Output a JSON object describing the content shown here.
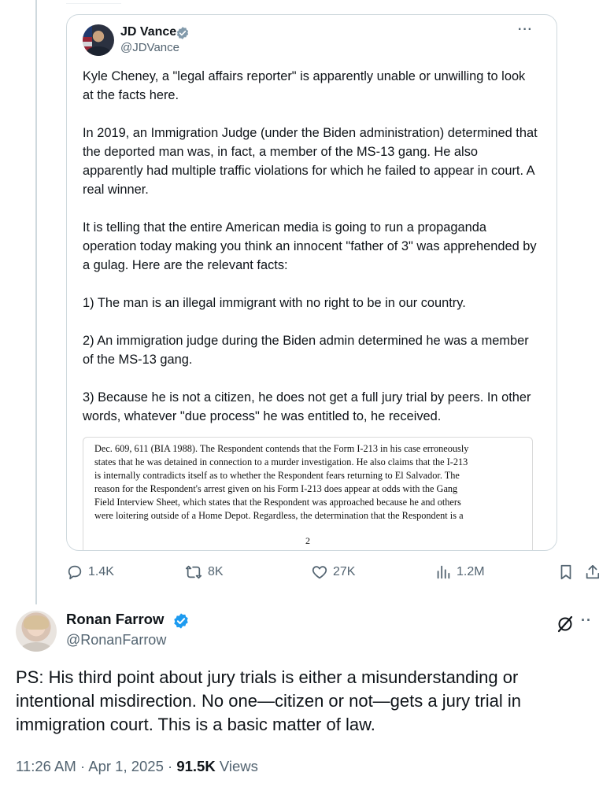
{
  "quoted_post": {
    "author_name": "JD Vance",
    "author_handle": "@JDVance",
    "more_label": "···",
    "paragraphs": [
      "Kyle Cheney, a \"legal affairs reporter\" is apparently unable or unwilling to look at the facts here.",
      "In 2019, an Immigration Judge (under the Biden administration) determined that the deported man was, in fact, a member of the MS-13 gang. He also apparently had multiple traffic violations for which he failed to appear in court. A real winner.",
      "It is telling that the entire American media is going to run a propaganda operation today making you think an innocent \"father of 3\" was apprehended by a gulag. Here are the relevant facts:",
      "1) The man is an illegal immigrant with no right to be in our country.",
      "2) An immigration judge during the Biden admin determined he was a member of the MS-13 gang.",
      "3) Because he is not a citizen, he does not get a full jury trial by peers. In other words, whatever \"due process\" he was entitled to, he received."
    ],
    "document_lines": [
      "Dec. 609, 611 (BIA 1988). The Respondent contends that the Form I-213 in his case erroneously",
      "states that he was detained in connection to a murder investigation. He also claims that the I-213",
      "is internally contradicts itself as to whether the Respondent fears returning to El Salvador. The",
      "reason for the Respondent's arrest given on his Form I-213 does appear at odds with the Gang",
      "Field Interview Sheet, which states that the Respondent was approached because he and others",
      "were loitering outside of a Home Depot. Regardless, the determination that the Respondent is a"
    ],
    "document_page_number": "2"
  },
  "actions": {
    "replies": "1.4K",
    "reposts": "8K",
    "likes": "27K",
    "views": "1.2M"
  },
  "main_post": {
    "author_name": "Ronan Farrow",
    "author_handle": "@RonanFarrow",
    "more_label": "··",
    "text": "PS: His third point about jury trials is either a misunderstanding or intentional misdirection. No one—citizen or not—gets a jury trial in immigration court. This is a basic matter of law.",
    "time": "11:26 AM",
    "date": "Apr 1, 2025",
    "separator": "·",
    "view_count": "91.5K",
    "views_label": "Views"
  },
  "colors": {
    "verified": "#1d9bf0",
    "muted_text": "#536471",
    "primary_text": "#0f1419",
    "border": "#cfd9de"
  }
}
